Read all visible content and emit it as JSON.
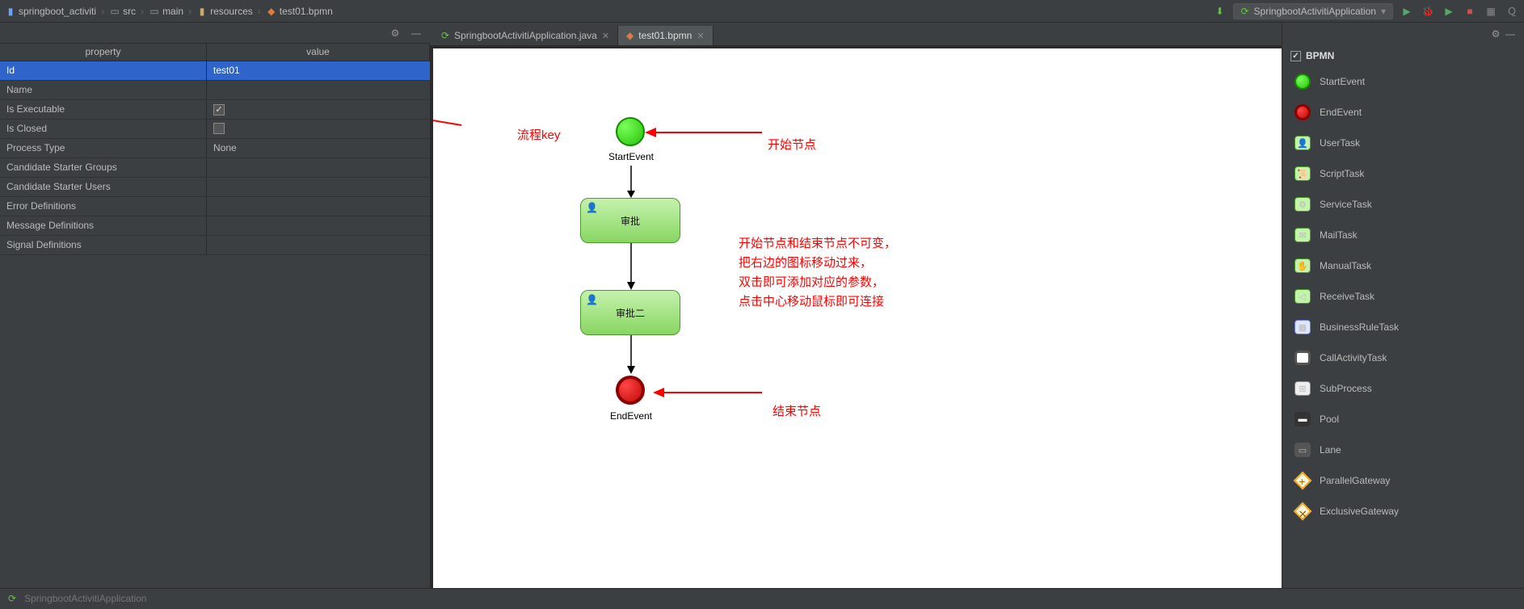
{
  "breadcrumb": {
    "project": "springboot_activiti",
    "src": "src",
    "main": "main",
    "resources": "resources",
    "file": "test01.bpmn"
  },
  "run_config": "SpringbootActivitiApplication",
  "tabs": [
    {
      "label": "SpringbootActivitiApplication.java",
      "active": false
    },
    {
      "label": "test01.bpmn",
      "active": true
    }
  ],
  "property_table": {
    "headers": {
      "property": "property",
      "value": "value"
    },
    "rows": [
      {
        "name": "Id",
        "value": "test01",
        "selected": true,
        "type": "text"
      },
      {
        "name": "Name",
        "value": "",
        "type": "text"
      },
      {
        "name": "Is Executable",
        "value": "",
        "type": "checkbox",
        "checked": true
      },
      {
        "name": "Is Closed",
        "value": "",
        "type": "checkbox",
        "checked": false
      },
      {
        "name": "Process Type",
        "value": "None",
        "type": "text"
      },
      {
        "name": "Candidate Starter Groups",
        "value": "",
        "type": "text"
      },
      {
        "name": "Candidate Starter Users",
        "value": "",
        "type": "text"
      },
      {
        "name": "Error Definitions",
        "value": "",
        "type": "text"
      },
      {
        "name": "Message Definitions",
        "value": "",
        "type": "text"
      },
      {
        "name": "Signal Definitions",
        "value": "",
        "type": "text"
      }
    ]
  },
  "canvas": {
    "start_event_label": "StartEvent",
    "task1_label": "审批",
    "task2_label": "审批二",
    "end_event_label": "EndEvent"
  },
  "annotations": {
    "flow_key": "流程key",
    "start_node": "开始节点",
    "end_node": "结束节点",
    "instructions_l1": "开始节点和结束节点不可变，",
    "instructions_l2": "把右边的图标移动过来，",
    "instructions_l3": "双击即可添加对应的参数，",
    "instructions_l4": "点击中心移动鼠标即可连接"
  },
  "palette": {
    "title": "BPMN",
    "items": [
      {
        "label": "StartEvent",
        "icon": "circle-green"
      },
      {
        "label": "EndEvent",
        "icon": "circle-red"
      },
      {
        "label": "UserTask",
        "icon": "user"
      },
      {
        "label": "ScriptTask",
        "icon": "script"
      },
      {
        "label": "ServiceTask",
        "icon": "gear"
      },
      {
        "label": "MailTask",
        "icon": "mail"
      },
      {
        "label": "ManualTask",
        "icon": "manual"
      },
      {
        "label": "ReceiveTask",
        "icon": "receive"
      },
      {
        "label": "BusinessRuleTask",
        "icon": "rule"
      },
      {
        "label": "CallActivityTask",
        "icon": "call"
      },
      {
        "label": "SubProcess",
        "icon": "sub"
      },
      {
        "label": "Pool",
        "icon": "pool"
      },
      {
        "label": "Lane",
        "icon": "lane"
      },
      {
        "label": "ParallelGateway",
        "icon": "parallel"
      },
      {
        "label": "ExclusiveGateway",
        "icon": "exclusive"
      }
    ]
  },
  "bottom": {
    "run_app": "SpringbootActivitiApplication"
  }
}
